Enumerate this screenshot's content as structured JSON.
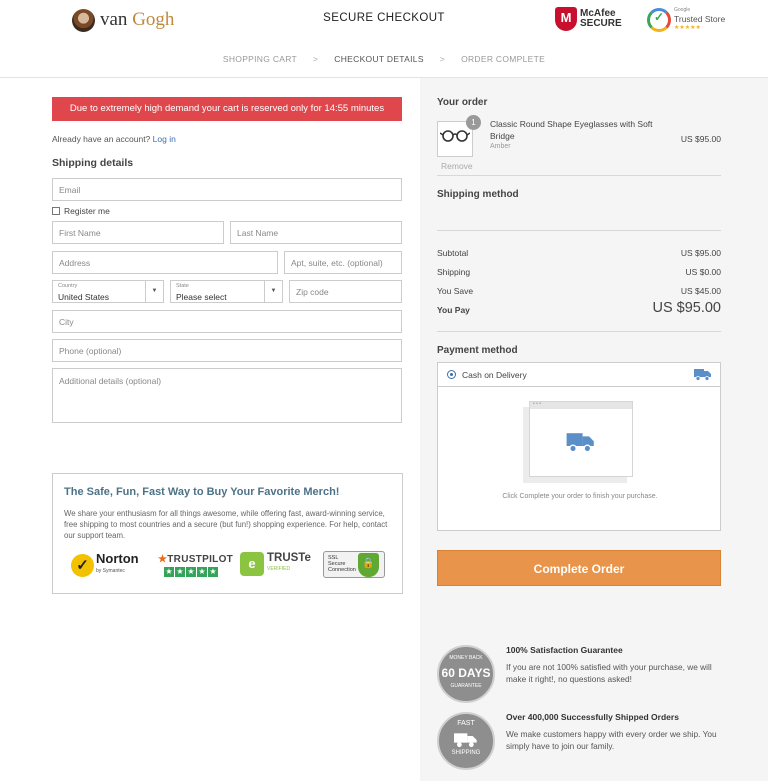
{
  "header": {
    "logo": {
      "text_main": "van ",
      "text_accent": "Gogh"
    },
    "title": "SECURE CHECKOUT",
    "mcafee": {
      "letter": "M",
      "line1": "McAfee",
      "line2": "SECURE"
    },
    "trusted": {
      "small": "Google",
      "label": "Trusted Store",
      "stars": "★★★★★"
    }
  },
  "steps": [
    {
      "label": "SHOPPING CART"
    },
    {
      "label": "CHECKOUT DETAILS"
    },
    {
      "label": "ORDER COMPLETE"
    }
  ],
  "step_separator": ">",
  "timer_message": "Due to extremely high demand your cart is reserved only for 14:55 minutes",
  "account": {
    "prompt": "Already have an account?",
    "login": "Log in"
  },
  "shipping": {
    "title": "Shipping details",
    "email_placeholder": "Email",
    "register_label": "Register me",
    "first_name_placeholder": "First Name",
    "last_name_placeholder": "Last Name",
    "address_placeholder": "Address",
    "apt_placeholder": "Apt, suite, etc. (optional)",
    "country": {
      "label": "Country",
      "value": "United States"
    },
    "state": {
      "label": "State",
      "value": "Please select"
    },
    "zip_placeholder": "Zip code",
    "city_placeholder": "City",
    "phone_placeholder": "Phone (optional)",
    "additional_placeholder": "Additional details (optional)"
  },
  "promo": {
    "title": "The Safe, Fun, Fast Way to Buy Your Favorite Merch!",
    "text": "We share your enthusiasm for all things awesome, while offering fast, award-winning service, free shipping to most countries and a secure (but fun!) shopping experience. For help, contact our support team.",
    "norton": {
      "name": "Norton",
      "sub": "by Symantec"
    },
    "trustpilot": {
      "name_a": "TRUST",
      "name_b": "PILOT"
    },
    "truste": {
      "name": "TRUSTe",
      "sub": "VERIFIED"
    },
    "ssl": {
      "line1": "SSL",
      "line2": "Secure",
      "line3": "Connection"
    }
  },
  "order": {
    "title": "Your order",
    "item": {
      "quantity": "1",
      "name": "Classic Round Shape Eyeglasses with Soft Bridge",
      "variant": "Amber",
      "price": "US $95.00",
      "remove": "Remove"
    },
    "shipping_method_title": "Shipping method",
    "summary": {
      "subtotal_label": "Subtotal",
      "subtotal": "US $95.00",
      "shipping_label": "Shipping",
      "shipping": "US $0.00",
      "save_label": "You Save",
      "save": "US $45.00",
      "pay_label": "You Pay",
      "pay": "US $95.00"
    },
    "payment": {
      "title": "Payment method",
      "option": "Cash on Delivery",
      "note": "Click Complete your order to finish your purchase."
    },
    "complete_button": "Complete Order"
  },
  "guarantees": [
    {
      "badge_big": "60 DAYS",
      "badge_top": "MONEY BACK",
      "badge_bottom": "GUARANTEE",
      "title": "100% Satisfaction Guarantee",
      "text": "If you are not 100% satisfied with your purchase, we will make it right!, no questions asked!"
    },
    {
      "badge_big": "FAST",
      "badge_top": "",
      "badge_bottom": "SHIPPING",
      "title": "Over 400,000 Successfully Shipped Orders",
      "text": "We make customers happy with every order we ship. You simply have to join our family."
    }
  ],
  "icons": {
    "glasses": "eyeglasses-icon",
    "truck": "delivery-truck-icon"
  },
  "colors": {
    "accent": "#e8944a",
    "alert": "#e0474c",
    "link": "#3a6fb0",
    "promo_title": "#4d7287"
  }
}
